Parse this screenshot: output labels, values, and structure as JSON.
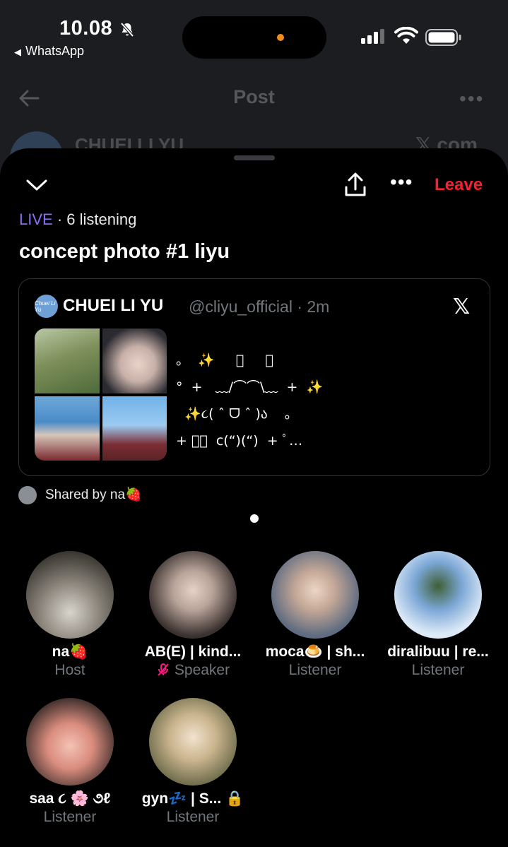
{
  "status_bar": {
    "time": "10.08",
    "back_app": "WhatsApp"
  },
  "background": {
    "title": "Post",
    "author": "CHUEI LI YU",
    "source": "𝕏.com"
  },
  "space": {
    "live_label": "LIVE",
    "listening_text": " · 6 listening",
    "title": "concept photo #1 liyu",
    "leave_label": "Leave",
    "more_label": "•••"
  },
  "pinned_post": {
    "avatar_text": "Chuei Li Yu",
    "author": "CHUEI LI YU",
    "handle": "@cliyu_official · 2m",
    "x_logo": "𝕏",
    "kaomoji": "。  ✨     ﾟ     ﾟ\n°  +   ﹏/⌒⌒\\﹏  +  ✨\n  ✨૮( ˆ ᗜ ˆ )ა    。\n+ ﾟ。  c(“)(“)  + ﾟ…"
  },
  "shared_by": "Shared by na🍓",
  "members": [
    {
      "name": "na🍓",
      "role": "Host",
      "color": "#5a5650"
    },
    {
      "name": "AB(E) | kind...",
      "role": "Speaker",
      "color": "#4b4d50"
    },
    {
      "name": "moca🍮 | sh...",
      "role": "Listener",
      "color": "#6d7788"
    },
    {
      "name": "diralibuu | re...",
      "role": "Listener",
      "color": "#8fb1d8"
    },
    {
      "name": "saa ૮ 🌸 ૭ℓ",
      "role": "Listener",
      "color": "#b07868"
    },
    {
      "name": "gyn💤 | S... 🔒",
      "role": "Listener",
      "color": "#7a7658"
    }
  ],
  "colors": {
    "live": "#8d6cf5",
    "leave": "#f4212e",
    "speaker_mic": "#f91880"
  }
}
